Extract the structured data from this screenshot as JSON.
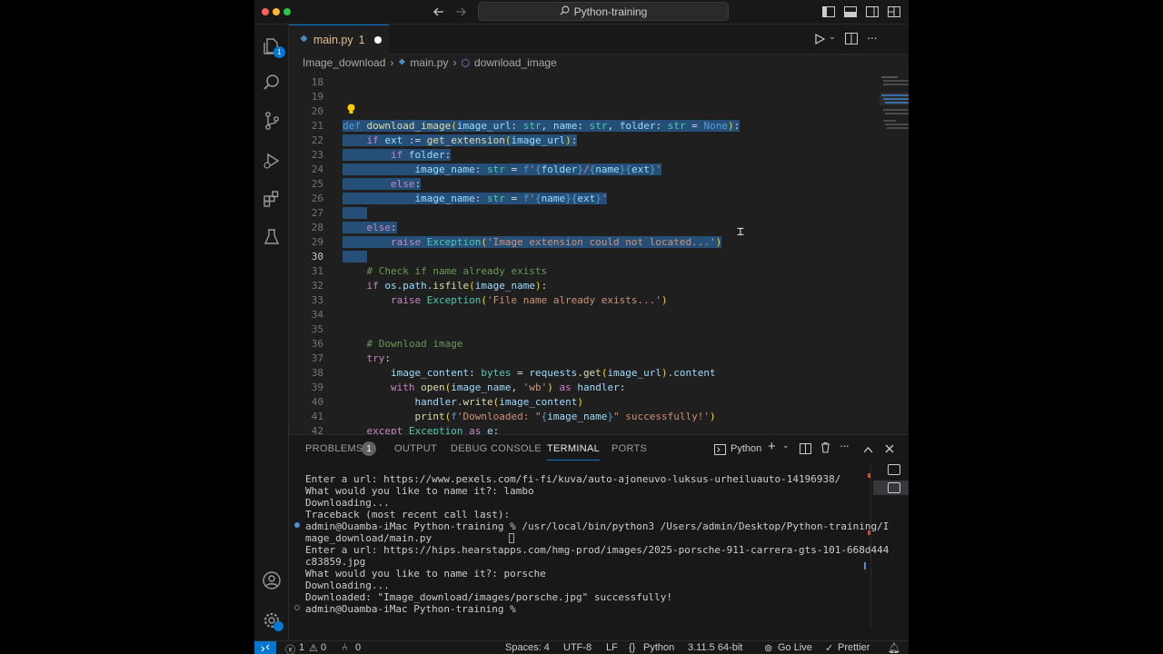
{
  "window": {
    "search_text": "Python-training",
    "traffic_lights": [
      "#ff5f57",
      "#febc2e",
      "#28c840"
    ]
  },
  "activity_bar": {
    "explorer_badge": "1",
    "items": [
      "files-icon",
      "search-icon",
      "source-control-icon",
      "run-debug-icon",
      "extensions-icon",
      "testing-icon"
    ],
    "bottom": [
      "account-icon",
      "settings-icon"
    ]
  },
  "tab": {
    "label": "main.py",
    "problem_count": "1"
  },
  "breadcrumb": {
    "folder": "Image_download",
    "file": "main.py",
    "symbol": "download_image"
  },
  "editor": {
    "lines": [
      {
        "n": "18",
        "html": ""
      },
      {
        "n": "19",
        "html": ""
      },
      {
        "n": "20",
        "html": ""
      },
      {
        "n": "21",
        "html": "<span class='sel'><span class='k'>def</span> <span class='f'>download_image</span><span class='b'>(</span><span class='v'>image_url</span><span class='o'>: </span><span class='t'>str</span><span class='o'>, </span><span class='v'>name</span><span class='o'>: </span><span class='t'>str</span><span class='o'>, </span><span class='v'>folder</span><span class='o'>: </span><span class='t'>str</span><span class='o'> = </span><span class='k'>None</span><span class='b'>)</span><span class='o'>:</span></span>"
      },
      {
        "n": "22",
        "html": "<span class='sel'>    <span class='kw'>if</span> <span class='v'>ext</span><span class='o'> := </span><span class='f'>get_extension</span><span class='b'>(</span><span class='v'>image_url</span><span class='b'>)</span><span class='o'>:</span></span>"
      },
      {
        "n": "23",
        "html": "<span class='sel'>        <span class='kw'>if</span> <span class='v'>folder</span><span class='o'>:</span></span>"
      },
      {
        "n": "24",
        "html": "<span class='sel'>            <span class='v'>image_name</span><span class='o'>: </span><span class='t'>str</span><span class='o'> = </span><span class='k'>f</span><span class='s'>'</span><span class='k'>{</span><span class='v'>folder</span><span class='k'>}</span><span class='s'>/</span><span class='k'>{</span><span class='v'>name</span><span class='k'>}{</span><span class='v'>ext</span><span class='k'>}</span><span class='s'>'</span></span>"
      },
      {
        "n": "25",
        "html": "<span class='sel'>        <span class='kw'>else</span><span class='o'>:</span></span>"
      },
      {
        "n": "26",
        "html": "<span class='sel'>            <span class='v'>image_name</span><span class='o'>: </span><span class='t'>str</span><span class='o'> = </span><span class='k'>f</span><span class='s'>'</span><span class='k'>{</span><span class='v'>name</span><span class='k'>}{</span><span class='v'>ext</span><span class='k'>}</span><span class='s'>'</span></span>"
      },
      {
        "n": "27",
        "html": "<span class='sel'>    </span>"
      },
      {
        "n": "28",
        "html": "<span class='sel'>    <span class='kw'>else</span><span class='o'>:</span></span>"
      },
      {
        "n": "29",
        "html": "<span class='sel'>        <span class='kw'>raise</span> <span class='t'>Exception</span><span class='b'>(</span><span class='s'>'Image extension could not located...'</span><span class='b'>)</span></span>"
      },
      {
        "n": "30",
        "html": "<span class='sel'>    </span>"
      },
      {
        "n": "31",
        "html": "    <span class='c'># Check if name already exists</span>"
      },
      {
        "n": "32",
        "html": "    <span class='kw'>if</span> <span class='v'>os</span><span class='o'>.</span><span class='v'>path</span><span class='o'>.</span><span class='f'>isfile</span><span class='b'>(</span><span class='v'>image_name</span><span class='b'>)</span><span class='o'>:</span>"
      },
      {
        "n": "33",
        "html": "        <span class='kw'>raise</span> <span class='t'>Exception</span><span class='b'>(</span><span class='s'>'File name already exists...'</span><span class='b'>)</span>"
      },
      {
        "n": "34",
        "html": ""
      },
      {
        "n": "35",
        "html": ""
      },
      {
        "n": "36",
        "html": "    <span class='c'># Download image</span>"
      },
      {
        "n": "37",
        "html": "    <span class='kw'>try</span><span class='o'>:</span>"
      },
      {
        "n": "38",
        "html": "        <span class='v'>image_content</span><span class='o'>: </span><span class='t'>bytes</span><span class='o'> = </span><span class='v'>requests</span><span class='o'>.</span><span class='f'>get</span><span class='b'>(</span><span class='v'>image_url</span><span class='b'>)</span><span class='o'>.</span><span class='v'>content</span>"
      },
      {
        "n": "39",
        "html": "        <span class='kw'>with</span> <span class='f'>open</span><span class='b'>(</span><span class='v'>image_name</span><span class='o'>, </span><span class='s'>'wb'</span><span class='b'>)</span> <span class='kw'>as</span> <span class='v'>handler</span><span class='o'>:</span>"
      },
      {
        "n": "40",
        "html": "            <span class='v'>handler</span><span class='o'>.</span><span class='f'>write</span><span class='b'>(</span><span class='v'>image_content</span><span class='b'>)</span>"
      },
      {
        "n": "41",
        "html": "            <span class='f'>print</span><span class='b'>(</span><span class='k'>f</span><span class='s'>'Downloaded: \"</span><span class='k'>{</span><span class='v'>image_name</span><span class='k'>}</span><span class='s'>\" successfully!'</span><span class='b'>)</span>"
      },
      {
        "n": "42",
        "html": "    <span class='kw'>except</span> <span class='t'>Exception</span> <span class='kw'>as</span> <span class='v'>e</span><span class='o'>:</span>"
      }
    ],
    "current_line": "30"
  },
  "panel": {
    "tabs": [
      "PROBLEMS",
      "OUTPUT",
      "DEBUG CONSOLE",
      "TERMINAL",
      "PORTS"
    ],
    "problems_badge": "1",
    "active_tab": "TERMINAL",
    "shell_label": "Python",
    "terminal_lines": [
      "Enter a url: https://www.pexels.com/fi-fi/kuva/auto-ajoneuvo-luksus-urheiluauto-14196938/",
      "What would you like to name it?: lambo",
      "Downloading...",
      "Traceback (most recent call last):",
      "admin@Ouamba-iMac Python-training % /usr/local/bin/python3 /Users/admin/Desktop/Python-training/I",
      "mage_download/main.py",
      "Enter a url: https://hips.hearstapps.com/hmg-prod/images/2025-porsche-911-carrera-gts-101-668d444",
      "c83859.jpg",
      "What would you like to name it?: porsche",
      "Downloading...",
      "Downloaded: \"Image_download/images/porsche.jpg\" successfully!",
      "admin@Ouamba-iMac Python-training % "
    ]
  },
  "status_bar": {
    "errors": "1",
    "warnings": "0",
    "ports": "0",
    "spaces": "Spaces: 4",
    "encoding": "UTF-8",
    "eol": "LF",
    "language": "Python",
    "interpreter": "3.11.5 64-bit",
    "go_live": "Go Live",
    "prettier": "Prettier"
  },
  "colors": {
    "accent": "#0078d4",
    "selection": "#264f78",
    "remote": "#0078d4"
  }
}
